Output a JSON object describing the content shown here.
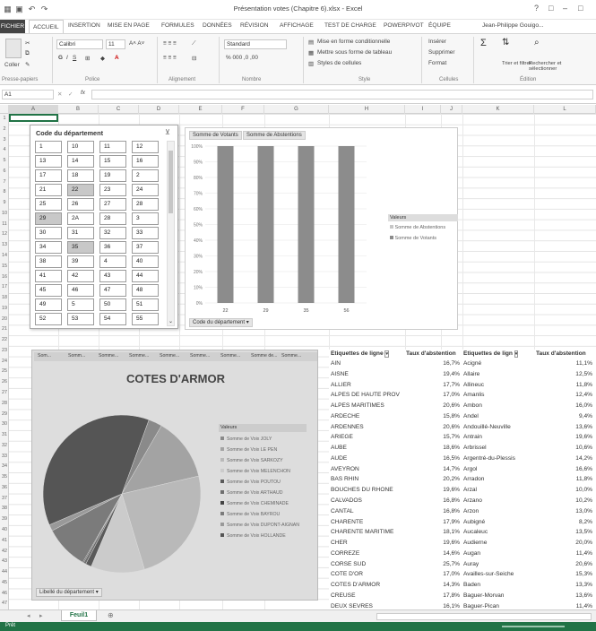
{
  "window": {
    "title": "Présentation votes (Chapitre 6).xlsx - Excel",
    "controls": [
      "?",
      "□",
      "–",
      "□"
    ]
  },
  "tabs": [
    "FICHIER",
    "ACCUEIL",
    "INSERTION",
    "MISE EN PAGE",
    "FORMULES",
    "DONNÉES",
    "RÉVISION",
    "AFFICHAGE",
    "TEST DE CHARGE",
    "POWERPIVOT",
    "ÉQUIPE"
  ],
  "user": "Jean-Philippe Gouigo...",
  "ribbon": {
    "paste": "Coller",
    "font_name": "Calibri",
    "font_size": "11",
    "number_format": "Standard",
    "cond_format": "Mise en forme conditionnelle",
    "table_format": "Mettre sous forme de tableau",
    "cell_styles": "Styles de cellules",
    "insert": "Insérer",
    "delete": "Supprimer",
    "format": "Format",
    "sort": "Trier et filtrer",
    "find": "Rechercher et sélectionner",
    "groups": [
      "Presse-papiers",
      "Police",
      "Alignement",
      "Nombre",
      "Style",
      "Cellules",
      "Édition"
    ]
  },
  "formula_bar": {
    "name_box": "A1",
    "fx": "fx",
    "value": ""
  },
  "columns": [
    "A",
    "B",
    "C",
    "D",
    "E",
    "F",
    "G",
    "H",
    "I",
    "J",
    "K",
    "L"
  ],
  "rows": [
    "1",
    "2",
    "3",
    "4",
    "5",
    "6",
    "7",
    "8",
    "9",
    "10",
    "11",
    "12",
    "13",
    "14",
    "15",
    "16",
    "17",
    "18",
    "19",
    "20",
    "21",
    "22",
    "23",
    "24",
    "25",
    "26",
    "27",
    "28",
    "29",
    "30",
    "31",
    "32",
    "33",
    "34",
    "35",
    "36",
    "37",
    "38",
    "39",
    "40",
    "41",
    "42",
    "43",
    "44",
    "45",
    "46",
    "47"
  ],
  "slicer": {
    "title": "Code du département",
    "items": [
      "1",
      "10",
      "11",
      "12",
      "13",
      "14",
      "15",
      "16",
      "17",
      "18",
      "19",
      "2",
      "21",
      "22",
      "23",
      "24",
      "25",
      "26",
      "27",
      "28",
      "29",
      "2A",
      "28",
      "3",
      "30",
      "31",
      "32",
      "33",
      "34",
      "35",
      "36",
      "37",
      "38",
      "39",
      "4",
      "40",
      "41",
      "42",
      "43",
      "44",
      "45",
      "46",
      "47",
      "48",
      "49",
      "5",
      "50",
      "51",
      "52",
      "53",
      "54",
      "55"
    ],
    "selected": [
      "22",
      "29",
      "35"
    ]
  },
  "chart1": {
    "field_buttons": [
      "Somme de Votants",
      "Somme de Abstentions"
    ],
    "axis_button": "Code du département",
    "legend_title": "Valeurs",
    "chart_data": {
      "type": "bar",
      "categories": [
        "22",
        "29",
        "35",
        "56"
      ],
      "series": [
        {
          "name": "Somme de Abstentions",
          "values": [
            0,
            0,
            0,
            0
          ]
        },
        {
          "name": "Somme de Votants",
          "values": [
            100,
            100,
            100,
            100
          ]
        }
      ],
      "ylim": [
        0,
        100
      ],
      "yticks": [
        "0%",
        "10%",
        "20%",
        "30%",
        "40%",
        "50%",
        "60%",
        "70%",
        "80%",
        "90%",
        "100%"
      ],
      "stacked_percent": true
    }
  },
  "chart2": {
    "title": "COTES D'ARMOR",
    "field_buttons": [
      "Som...",
      "Somm...",
      "Somme...",
      "Somme...",
      "Somme...",
      "Somme...",
      "Somme...",
      "Somme de...",
      "Somme..."
    ],
    "axis_button": "Libellé du département",
    "legend_title": "Valeurs",
    "colors": [
      "#8a8a8a",
      "#a3a3a3",
      "#b9b9b9",
      "#cbcbcb",
      "#5a5a5a",
      "#6e6e6e",
      "#444444",
      "#7b7b7b",
      "#999999",
      "#555555"
    ],
    "chart_data": {
      "type": "pie",
      "title": "COTES D'ARMOR",
      "series": [
        {
          "labels": [
            "Somme de Voix JOLY",
            "Somme de Voix LE PEN",
            "Somme de Voix SARKOZY",
            "Somme de Voix MELENCHON",
            "Somme de Voix POUTOU",
            "Somme de Voix ARTHAUD",
            "Somme de Voix CHEMINADE",
            "Somme de Voix BAYROU",
            "Somme de Voix DUPONT-AIGNAN",
            "Somme de Voix HOLLANDE"
          ],
          "values": [
            2.8,
            13.0,
            24.0,
            11.0,
            1.2,
            0.5,
            0.2,
            9.0,
            1.3,
            37.0
          ]
        }
      ]
    }
  },
  "pivot": {
    "left": {
      "header": "Étiquettes de ligne",
      "value_header": "Taux d'abstention",
      "rows": [
        [
          "AIN",
          "16,7%"
        ],
        [
          "AISNE",
          "19,4%"
        ],
        [
          "ALLIER",
          "17,7%"
        ],
        [
          "ALPES DE HAUTE PROV",
          "17,0%"
        ],
        [
          "ALPES MARITIMES",
          "20,6%"
        ],
        [
          "ARDECHE",
          "15,8%"
        ],
        [
          "ARDENNES",
          "20,6%"
        ],
        [
          "ARIEGE",
          "15,7%"
        ],
        [
          "AUBE",
          "18,6%"
        ],
        [
          "AUDE",
          "16,5%"
        ],
        [
          "AVEYRON",
          "14,7%"
        ],
        [
          "BAS RHIN",
          "20,2%"
        ],
        [
          "BOUCHES DU RHONE",
          "19,6%"
        ],
        [
          "CALVADOS",
          "16,8%"
        ],
        [
          "CANTAL",
          "16,8%"
        ],
        [
          "CHARENTE",
          "17,9%"
        ],
        [
          "CHARENTE MARITIME",
          "18,1%"
        ],
        [
          "CHER",
          "19,6%"
        ],
        [
          "CORREZE",
          "14,6%"
        ],
        [
          "CORSE SUD",
          "25,7%"
        ],
        [
          "COTE D'OR",
          "17,0%"
        ],
        [
          "COTES D'ARMOR",
          "14,3%"
        ],
        [
          "CREUSE",
          "17,8%"
        ],
        [
          "DEUX SEVRES",
          "16,1%"
        ]
      ]
    },
    "right": {
      "header": "Étiquettes de lign",
      "value_header": "Taux d'abstention",
      "rows": [
        [
          "Acigné",
          "11,1%"
        ],
        [
          "Allaire",
          "12,5%"
        ],
        [
          "Allineuc",
          "11,8%"
        ],
        [
          "Amanlis",
          "12,4%"
        ],
        [
          "Ambon",
          "16,0%"
        ],
        [
          "Andel",
          "9,4%"
        ],
        [
          "Andouillé-Neuville",
          "13,6%"
        ],
        [
          "Antrain",
          "19,6%"
        ],
        [
          "Arbrissel",
          "10,6%"
        ],
        [
          "Argentré-du-Plessis",
          "14,2%"
        ],
        [
          "Argol",
          "16,6%"
        ],
        [
          "Arradon",
          "11,8%"
        ],
        [
          "Arzal",
          "10,0%"
        ],
        [
          "Arzano",
          "10,2%"
        ],
        [
          "Arzon",
          "13,0%"
        ],
        [
          "Aubigné",
          "8,2%"
        ],
        [
          "Aucaleuc",
          "13,5%"
        ],
        [
          "Audierne",
          "20,0%"
        ],
        [
          "Augan",
          "11,4%"
        ],
        [
          "Auray",
          "20,6%"
        ],
        [
          "Availles-sur-Seiche",
          "15,3%"
        ],
        [
          "Baden",
          "13,3%"
        ],
        [
          "Baguer-Morvan",
          "13,6%"
        ],
        [
          "Baguer-Pican",
          "11,4%"
        ]
      ]
    }
  },
  "sheet_tab": "Feuil1",
  "status": "Prêt"
}
